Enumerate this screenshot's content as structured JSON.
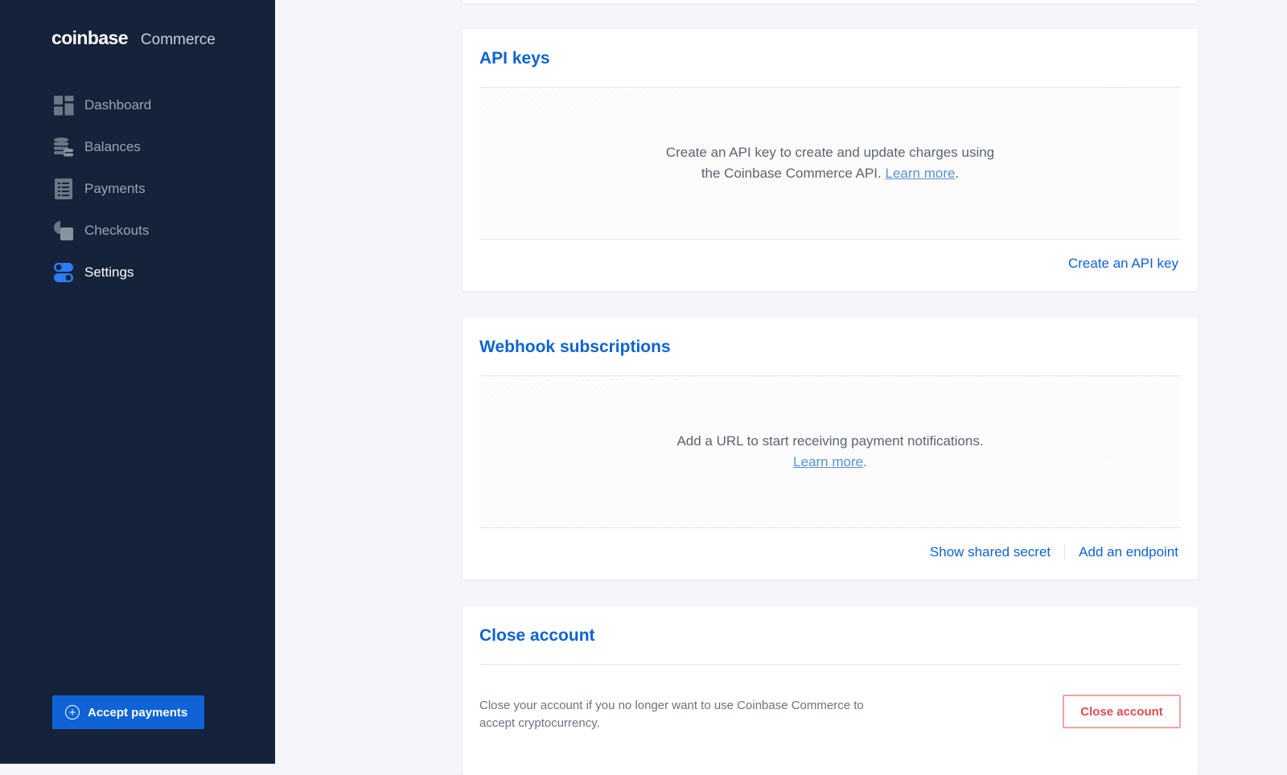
{
  "sidebar": {
    "logo_main": "coinbase",
    "logo_sub": "Commerce",
    "items": [
      {
        "label": "Dashboard",
        "icon": "dashboard-grid-icon",
        "active": false
      },
      {
        "label": "Balances",
        "icon": "coin-stack-icon",
        "active": false
      },
      {
        "label": "Payments",
        "icon": "receipt-list-icon",
        "active": false
      },
      {
        "label": "Checkouts",
        "icon": "checkout-shapes-icon",
        "active": false
      },
      {
        "label": "Settings",
        "icon": "toggle-switches-icon",
        "active": true
      }
    ],
    "accept_button_label": "Accept payments",
    "accept_button_icon": "plus-circle-icon"
  },
  "colors": {
    "sidebar_bg": "#15233a",
    "accent_blue": "#0d63d2",
    "danger": "#e14b50",
    "active_icon": "#2f7cf6"
  },
  "api_keys": {
    "title": "API keys",
    "empty_line1": "Create an API key to create and update charges using",
    "empty_line2": "the Coinbase Commerce API.",
    "learn_more": "Learn more",
    "period": ".",
    "create_label": "Create an API key"
  },
  "webhooks": {
    "title": "Webhook subscriptions",
    "empty_line1": "Add a URL to start receiving payment notifications.",
    "learn_more": "Learn more",
    "period": ".",
    "show_secret_label": "Show shared secret",
    "add_endpoint_label": "Add an endpoint"
  },
  "close_account": {
    "title": "Close account",
    "description": "Close your account if you no longer want to use Coinbase Commerce to accept cryptocurrency.",
    "button_label": "Close account"
  }
}
